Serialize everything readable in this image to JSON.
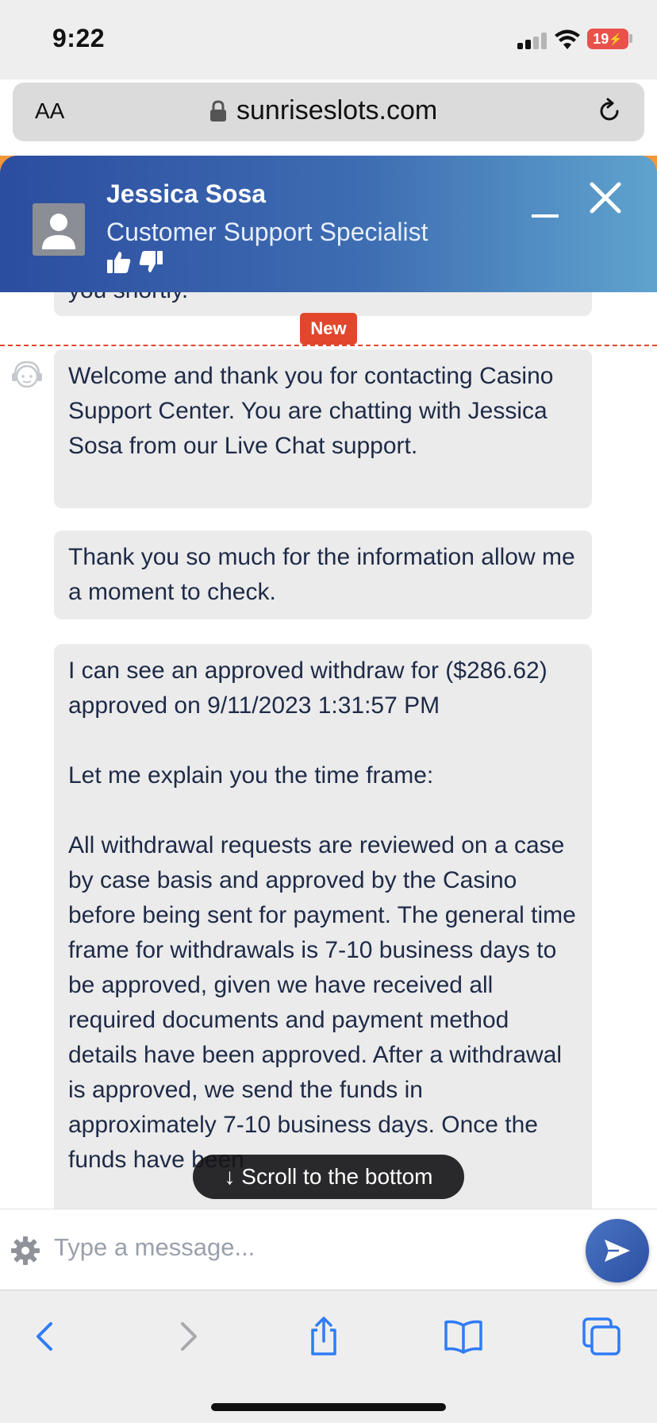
{
  "status_bar": {
    "time": "9:22",
    "battery": "19"
  },
  "browser": {
    "text_size_button": "AA",
    "url": "sunriseslots.com"
  },
  "chat": {
    "agent_name": "Jessica Sosa",
    "agent_role": "Customer Support Specialist",
    "new_badge": "New",
    "messages": [
      "you shortly.",
      "Welcome and thank you for contacting Casino Support Center. You are chatting with Jessica Sosa from our Live Chat support.",
      "Thank you so much for the information allow me a moment to check.",
      "I can see an approved withdraw for ($286.62) approved on 9/11/2023 1:31:57 PM\n\nLet me explain you the time frame:\n\nAll withdrawal requests are reviewed on a case by case basis and approved by the Casino before being sent for payment. The general time frame for withdrawals is 7-10 business days to be approved, given we have received all required documents and payment method details have been approved. After a withdrawal is approved, we send the funds in approximately 7-10 business days. Once the funds have been"
    ],
    "scroll_button": "↓ Scroll to the bottom",
    "composer": {
      "placeholder": "Type a message...",
      "value": ""
    }
  },
  "colors": {
    "header_start": "#2c4da0",
    "header_end": "#5fa3ce",
    "accent_orange": "#f4973a",
    "new_red": "#e2462c",
    "safari_blue": "#2f7cf6"
  },
  "icons": [
    "lock-icon",
    "reload-icon",
    "avatar-icon",
    "thumbs-up-icon",
    "thumbs-down-icon",
    "minimize-icon",
    "close-icon",
    "agent-icon",
    "gear-icon",
    "send-icon",
    "back-icon",
    "forward-icon",
    "share-icon",
    "bookmarks-icon",
    "tabs-icon"
  ]
}
